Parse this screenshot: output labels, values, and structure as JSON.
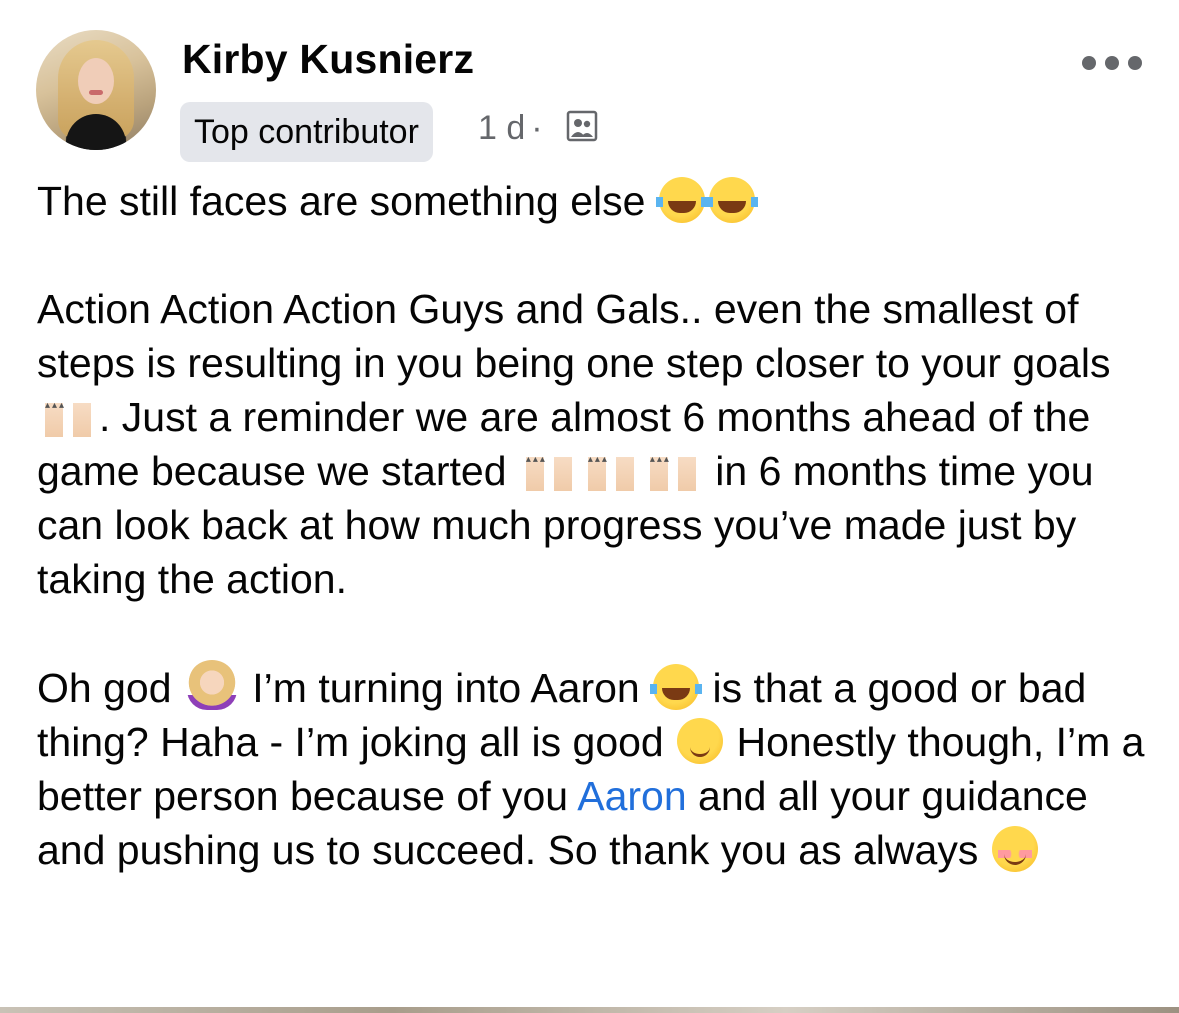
{
  "post": {
    "author": {
      "name": "Kirby Kusnierz",
      "badge": "Top contributor"
    },
    "meta": {
      "time": "1 d",
      "separator": "·",
      "audience_icon": "group-audience-icon"
    },
    "more_icon": "more-options-icon",
    "text": {
      "line1": "The still faces are something else",
      "para2_a": "Action Action Action Guys and Gals.. even the smallest of steps is resulting in you being one step closer to your goals ",
      "para2_b": ". Just a reminder we are almost 6 months ahead of the game because we started ",
      "para2_c": " in 6 months time you can look back at how much progress you’ve made just by taking the action.",
      "para3_a": "Oh god ",
      "para3_b": " I’m turning into Aaron ",
      "para3_c": " is that a good or bad thing? Haha - I’m joking all is good ",
      "para3_d": " Honestly though, I’m a better person because of you ",
      "mention": "Aaron",
      "para3_e": " and all your guidance and pushing us to succeed. So thank you as always "
    },
    "emojis": [
      "face-with-tears-of-joy",
      "raising-hands",
      "person-facepalming",
      "winking-face",
      "smiling-face"
    ]
  },
  "colors": {
    "text": "#050505",
    "secondary": "#65676b",
    "badge_bg": "#e4e6eb",
    "mention": "#216fdb"
  }
}
